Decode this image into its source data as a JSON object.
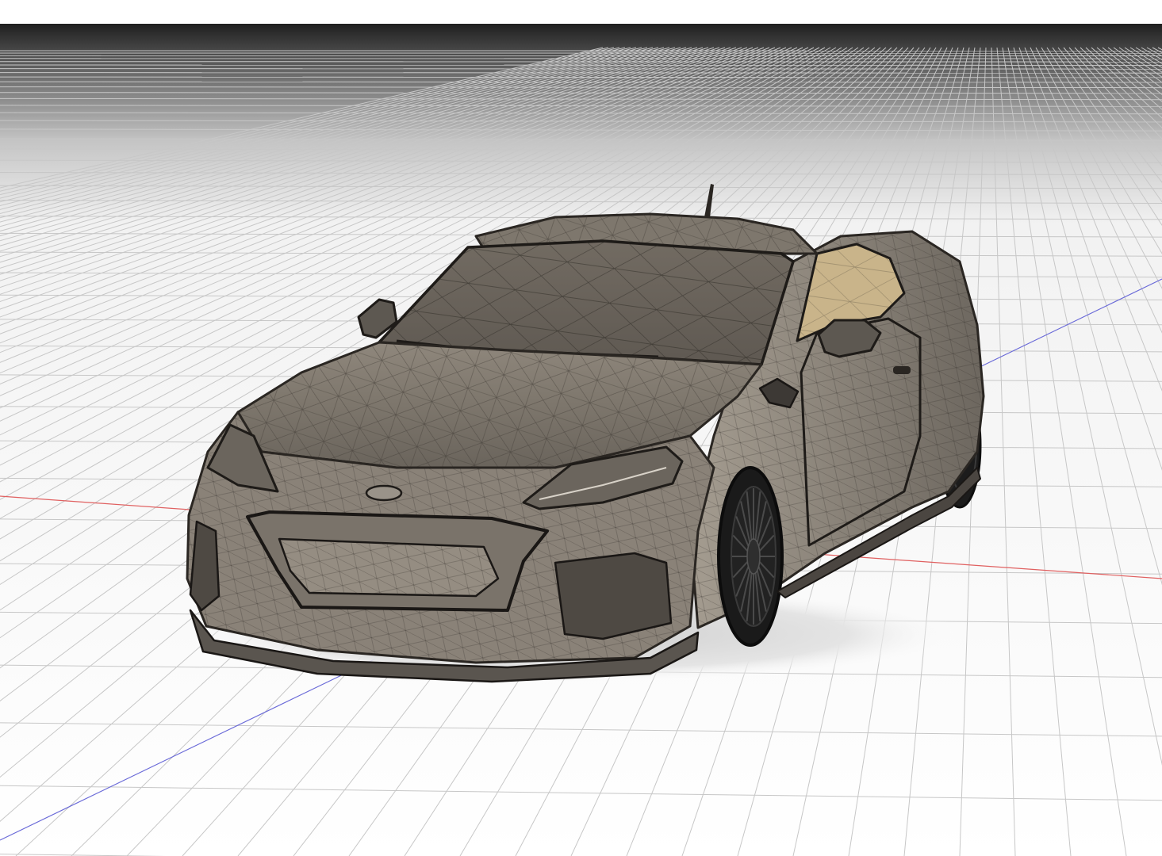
{
  "viewport": {
    "mode": "wireframe-shaded",
    "grid": true,
    "axes": {
      "x_color": "#e06060",
      "z_color": "#6a6ad8"
    },
    "background_top": "#1a1a1a",
    "background_bottom": "#ffffff"
  },
  "model": {
    "body_color": "#8b8377",
    "edge_color": "#2a2622",
    "interior_color": "#c9b48a",
    "wheel_color": "#1c1c1c",
    "shadow_color": "#d8d8d8"
  }
}
